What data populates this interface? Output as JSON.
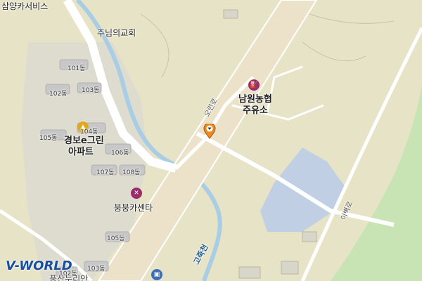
{
  "map": {
    "labels": {
      "samyang": "삼양카서비스",
      "church": "주님의교회",
      "namwon_line1": "남원농협",
      "namwon_line2": "주유소",
      "apt_line1": "경보e그린",
      "apt_line2": "아파트",
      "boongboong": "붕붕카센타",
      "stream": "고죽천",
      "road_main": "오런로",
      "road_right": "이벽로",
      "bottom_partial": "풍산누리안",
      "b101": "101동",
      "b102": "102동",
      "b103": "103동",
      "b104": "104동",
      "b105": "105동",
      "b106": "106동",
      "b107": "107동",
      "b108": "108동",
      "b105b": "105동",
      "b103b": "103동",
      "b102b": "102동"
    },
    "logo": "V-WORLD",
    "colors": {
      "land": "#e7e3c6",
      "road": "#ffffff",
      "expressway": "#ece3cc",
      "water": "#b9d4ea",
      "park": "#c9e4b4",
      "gasStation": "#9b2c6a",
      "carCenter": "#9b2c6a",
      "marker": "#f08a1a"
    }
  }
}
